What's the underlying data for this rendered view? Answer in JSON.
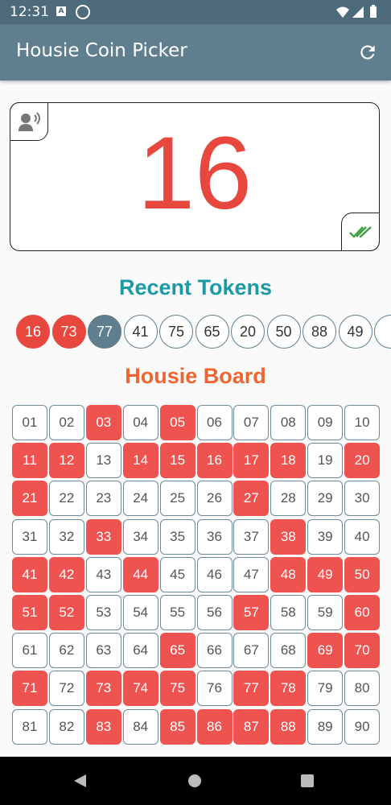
{
  "status_bar": {
    "time": "12:31",
    "icons": [
      "a-notification-icon",
      "at-sign-icon",
      "wifi-icon",
      "signal-icon",
      "battery-icon"
    ]
  },
  "app_bar": {
    "title": "Housie Coin Picker",
    "action_icon": "refresh-icon"
  },
  "display": {
    "current_number": "16",
    "speak_icon": "speak-icon",
    "confirm_icon": "double-check-icon"
  },
  "recent": {
    "title": "Recent Tokens",
    "tokens": [
      {
        "value": "16",
        "style": "red"
      },
      {
        "value": "73",
        "style": "red"
      },
      {
        "value": "77",
        "style": "slate"
      },
      {
        "value": "41",
        "style": "plain"
      },
      {
        "value": "75",
        "style": "plain"
      },
      {
        "value": "65",
        "style": "plain"
      },
      {
        "value": "20",
        "style": "plain"
      },
      {
        "value": "50",
        "style": "plain"
      },
      {
        "value": "88",
        "style": "plain"
      },
      {
        "value": "49",
        "style": "plain"
      },
      {
        "value": "",
        "style": "plain"
      }
    ]
  },
  "board": {
    "title": "Housie Board",
    "numbers": [
      "01",
      "02",
      "03",
      "04",
      "05",
      "06",
      "07",
      "08",
      "09",
      "10",
      "11",
      "12",
      "13",
      "14",
      "15",
      "16",
      "17",
      "18",
      "19",
      "20",
      "21",
      "22",
      "23",
      "24",
      "25",
      "26",
      "27",
      "28",
      "29",
      "30",
      "31",
      "32",
      "33",
      "34",
      "35",
      "36",
      "37",
      "38",
      "39",
      "40",
      "41",
      "42",
      "43",
      "44",
      "45",
      "46",
      "47",
      "48",
      "49",
      "50",
      "51",
      "52",
      "53",
      "54",
      "55",
      "56",
      "57",
      "58",
      "59",
      "60",
      "61",
      "62",
      "63",
      "64",
      "65",
      "66",
      "67",
      "68",
      "69",
      "70",
      "71",
      "72",
      "73",
      "74",
      "75",
      "76",
      "77",
      "78",
      "79",
      "80",
      "81",
      "82",
      "83",
      "84",
      "85",
      "86",
      "87",
      "88",
      "89",
      "90"
    ],
    "drawn": [
      "03",
      "05",
      "11",
      "12",
      "14",
      "15",
      "16",
      "17",
      "18",
      "20",
      "21",
      "27",
      "33",
      "38",
      "41",
      "42",
      "44",
      "48",
      "49",
      "50",
      "51",
      "52",
      "57",
      "60",
      "65",
      "69",
      "70",
      "71",
      "73",
      "74",
      "75",
      "77",
      "78",
      "83",
      "85",
      "86",
      "87",
      "88"
    ]
  },
  "colors": {
    "drawn": "#ef5350",
    "accent_teal": "#1a9aa6",
    "accent_orange": "#ee6530",
    "app_bar": "#5f7f8f"
  }
}
